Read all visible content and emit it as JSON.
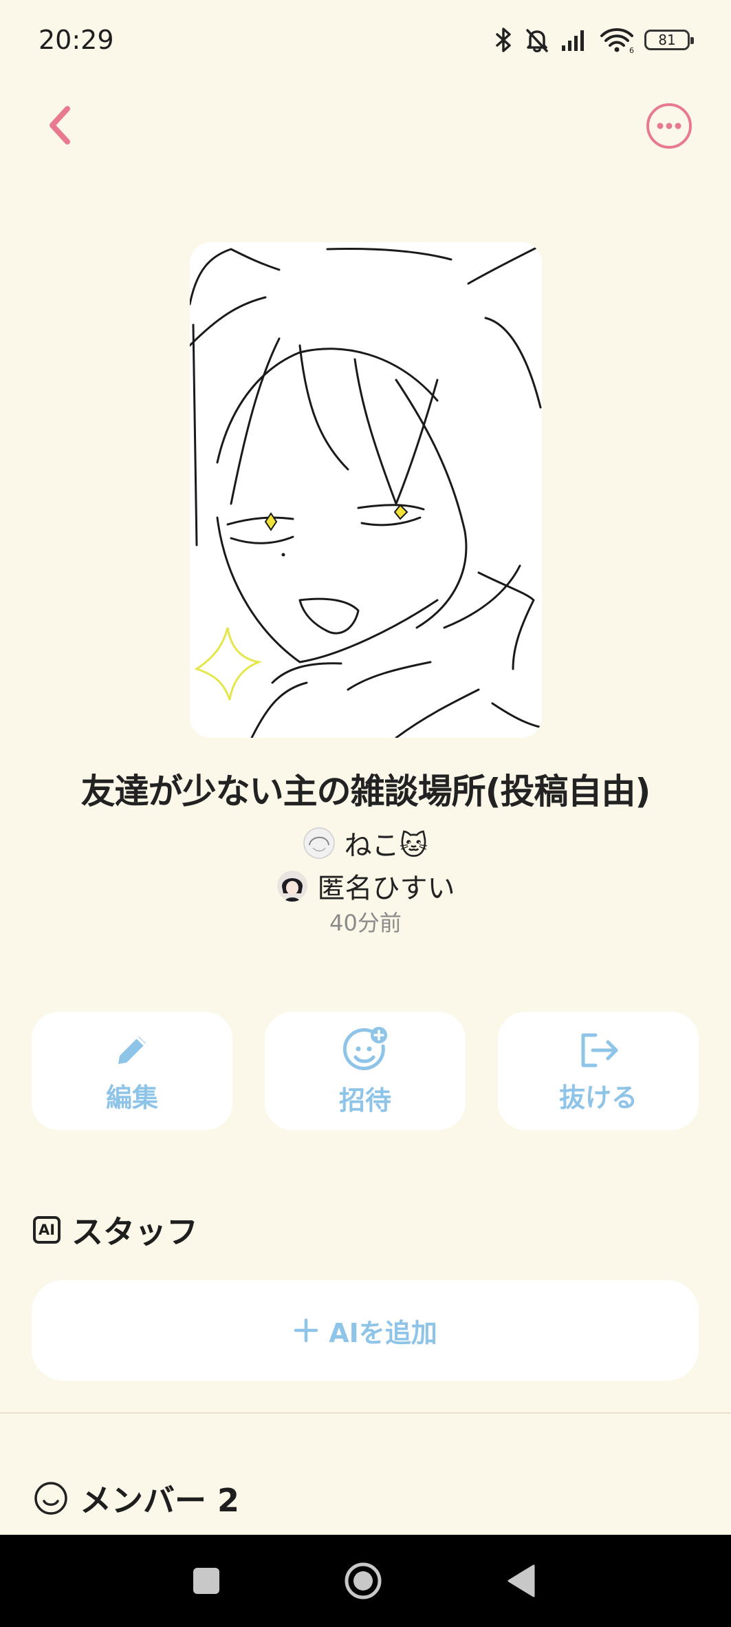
{
  "status_bar": {
    "time": "20:29",
    "battery": "81"
  },
  "room": {
    "title": "友達が少ない主の雑談場所(投稿自由)",
    "owner_name": "ねこ🐱",
    "member_name": "匿名ひすい",
    "time_ago": "40分前"
  },
  "actions": {
    "edit": "編集",
    "invite": "招待",
    "leave": "抜ける"
  },
  "staff": {
    "title": "スタッフ",
    "ai_badge": "AI",
    "add_ai": "AIを追加"
  },
  "members": {
    "title": "メンバー 2"
  },
  "colors": {
    "accent_pink": "#e87a8e",
    "accent_blue": "#8ec4e8",
    "background": "#fcf8e9"
  }
}
